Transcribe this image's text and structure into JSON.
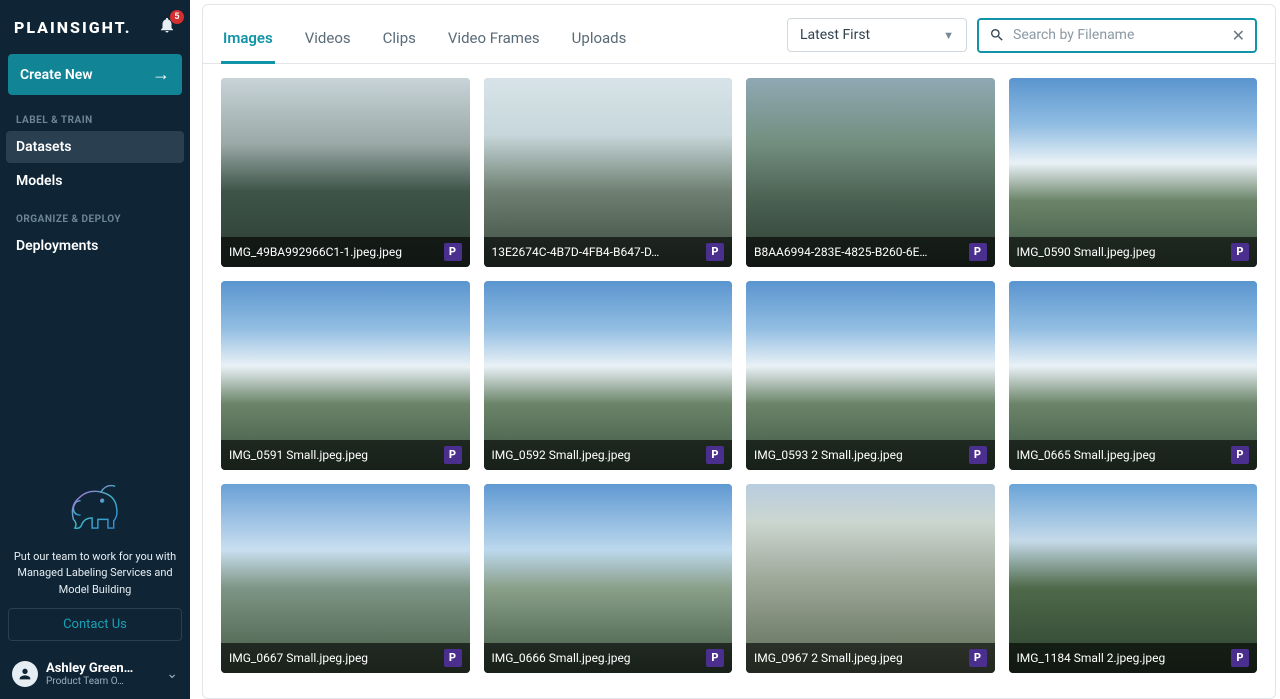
{
  "brand": "PLAINSIGHT.",
  "notification_count": "5",
  "create_label": "Create New",
  "sections": {
    "label_train": {
      "header": "LABEL & TRAIN",
      "items": [
        "Datasets",
        "Models"
      ],
      "active_index": 0
    },
    "organize_deploy": {
      "header": "ORGANIZE & DEPLOY",
      "items": [
        "Deployments"
      ]
    }
  },
  "promo_text": "Put our team to work for you with Managed Labeling Services and Model Building",
  "contact_label": "Contact Us",
  "user": {
    "name": "Ashley Green…",
    "sub": "Product Team O…"
  },
  "tabs": [
    "Images",
    "Videos",
    "Clips",
    "Video Frames",
    "Uploads"
  ],
  "active_tab_index": 0,
  "sort_selected": "Latest First",
  "search_placeholder": "Search by Filename",
  "badge_letter": "P",
  "images": [
    {
      "filename": "IMG_49BA992966C1-1.jpeg.jpeg",
      "style": "t-fall1"
    },
    {
      "filename": "13E2674C-4B7D-4FB4-B647-D…",
      "style": "t-fall2"
    },
    {
      "filename": "B8AA6994-283E-4825-B260-6E…",
      "style": "t-fall3"
    },
    {
      "filename": "IMG_0590 Small.jpeg.jpeg",
      "style": "t-valley"
    },
    {
      "filename": "IMG_0591 Small.jpeg.jpeg",
      "style": "t-valley"
    },
    {
      "filename": "IMG_0592 Small.jpeg.jpeg",
      "style": "t-valley"
    },
    {
      "filename": "IMG_0593 2 Small.jpeg.jpeg",
      "style": "t-valley"
    },
    {
      "filename": "IMG_0665 Small.jpeg.jpeg",
      "style": "t-valley"
    },
    {
      "filename": "IMG_0667 Small.jpeg.jpeg",
      "style": "t-hill1"
    },
    {
      "filename": "IMG_0666 Small.jpeg.jpeg",
      "style": "t-hill2"
    },
    {
      "filename": "IMG_0967 2 Small.jpeg.jpeg",
      "style": "t-cliff"
    },
    {
      "filename": "IMG_1184 Small 2.jpeg.jpeg",
      "style": "t-trees"
    }
  ]
}
